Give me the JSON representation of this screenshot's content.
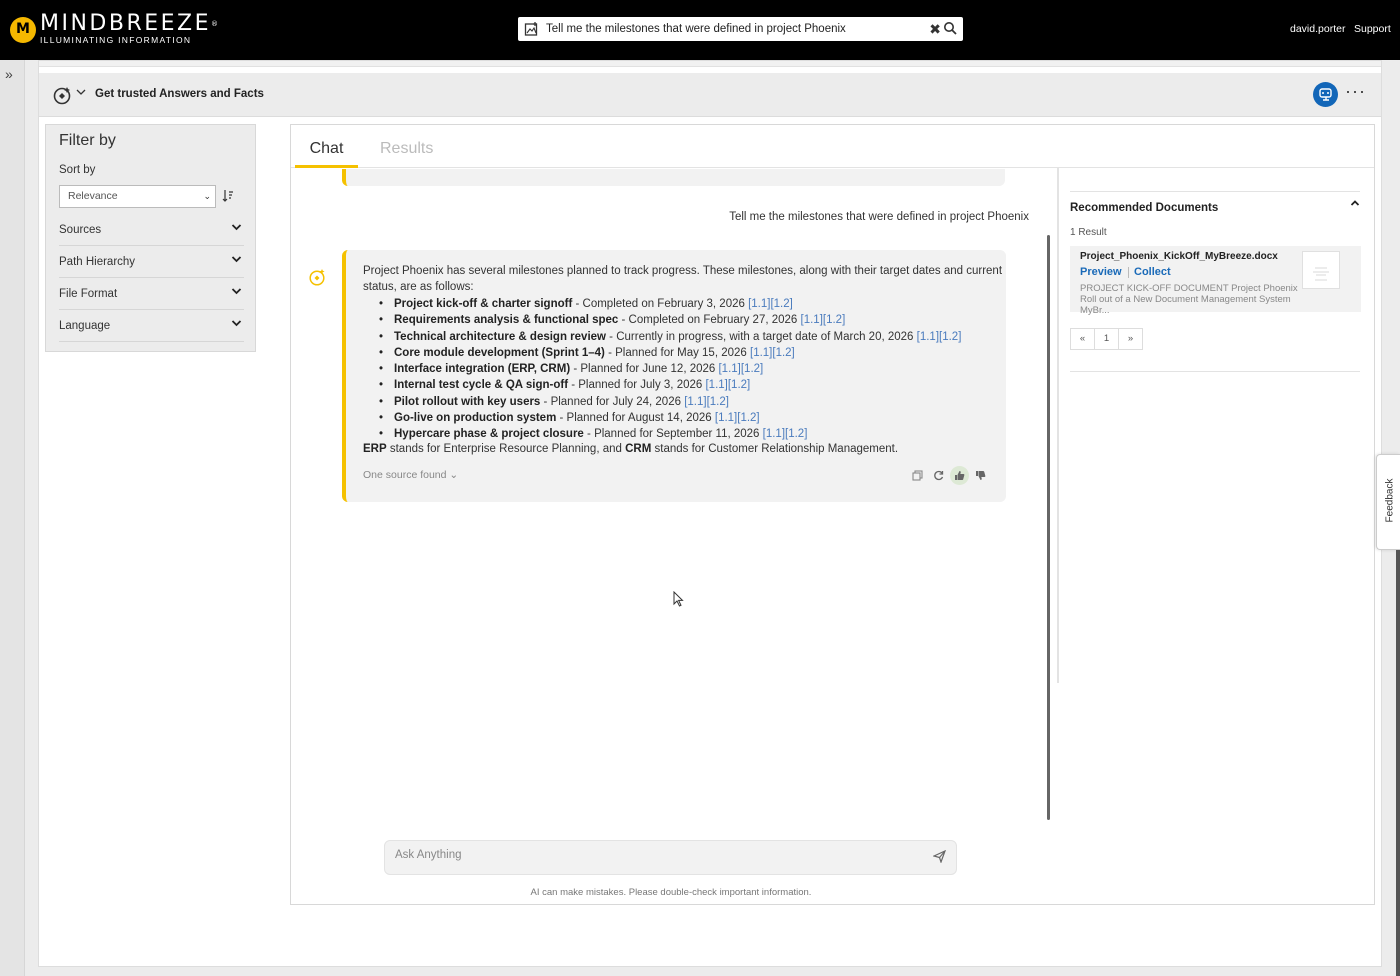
{
  "header": {
    "logo_name": "MINDBREEZE",
    "logo_mark": "®",
    "logo_tagline": "ILLUMINATING INFORMATION",
    "search_value": "Tell me the milestones that were defined in project Phoenix",
    "user": "david.porter",
    "support": "Support"
  },
  "section": {
    "title": "Get trusted Answers and Facts"
  },
  "filter": {
    "title": "Filter by",
    "sort_label": "Sort by",
    "sort_value": "Relevance",
    "facets": [
      "Sources",
      "Path Hierarchy",
      "File Format",
      "Language"
    ]
  },
  "tabs": {
    "chat": "Chat",
    "results": "Results"
  },
  "chat": {
    "user_message": "Tell me the milestones that were defined in project Phoenix",
    "answer_intro": "Project Phoenix has several milestones planned to track progress. These milestones, along with their target dates and current status, are as follows:",
    "milestones": [
      {
        "name": "Project kick-off & charter signoff",
        "detail": " - Completed on February 3, 2026 ",
        "cites": "[1.1][1.2]"
      },
      {
        "name": "Requirements analysis & functional spec",
        "detail": " - Completed on February 27, 2026 ",
        "cites": "[1.1][1.2]"
      },
      {
        "name": "Technical architecture & design review",
        "detail": " - Currently in progress, with a target date of March 20, 2026 ",
        "cites": "[1.1][1.2]"
      },
      {
        "name": "Core module development (Sprint 1–4)",
        "detail": " - Planned for May 15, 2026 ",
        "cites": "[1.1][1.2]"
      },
      {
        "name": "Interface integration (ERP, CRM)",
        "detail": " - Planned for June 12, 2026 ",
        "cites": "[1.1][1.2]"
      },
      {
        "name": "Internal test cycle & QA sign-off",
        "detail": " - Planned for July 3, 2026 ",
        "cites": "[1.1][1.2]"
      },
      {
        "name": "Pilot rollout with key users",
        "detail": " - Planned for July 24, 2026 ",
        "cites": "[1.1][1.2]"
      },
      {
        "name": "Go-live on production system",
        "detail": " - Planned for August 14, 2026 ",
        "cites": "[1.1][1.2]"
      },
      {
        "name": "Hypercare phase & project closure",
        "detail": " - Planned for September 11, 2026 ",
        "cites": "[1.1][1.2]"
      }
    ],
    "note_erp": "ERP",
    "note_erp_text": " stands for Enterprise Resource Planning, and ",
    "note_crm": "CRM",
    "note_crm_text": " stands for Customer Relationship Management.",
    "sources_toggle": "One source found ⌄",
    "ask_placeholder": "Ask Anything",
    "disclaimer": "AI can make mistakes. Please double-check important information."
  },
  "recommended": {
    "title": "Recommended Documents",
    "count": "1 Result",
    "doc_name": "Project_Phoenix_KickOff_MyBreeze.docx",
    "preview": "Preview",
    "collect": "Collect",
    "snippet": "PROJECT KICK-OFF DOCUMENT Project Phoenix Roll out of a New Document Management System MyBr...",
    "pager_prev": "«",
    "pager_page": "1",
    "pager_next": "»"
  },
  "feedback_tab": "Feedback",
  "colors": {
    "accent": "#f5c100",
    "link": "#1a6ab8",
    "topbar": "#000000"
  },
  "icons": [
    "image-search-icon",
    "clear-icon",
    "search-icon",
    "expand-sidebar-icon",
    "sparkle-chat-icon",
    "chevron-down-icon",
    "assistant-settings-icon",
    "more-icon",
    "sort-order-icon",
    "copy-icon",
    "regenerate-icon",
    "thumbs-up-icon",
    "thumbs-down-icon",
    "send-icon",
    "chevron-up-icon"
  ]
}
